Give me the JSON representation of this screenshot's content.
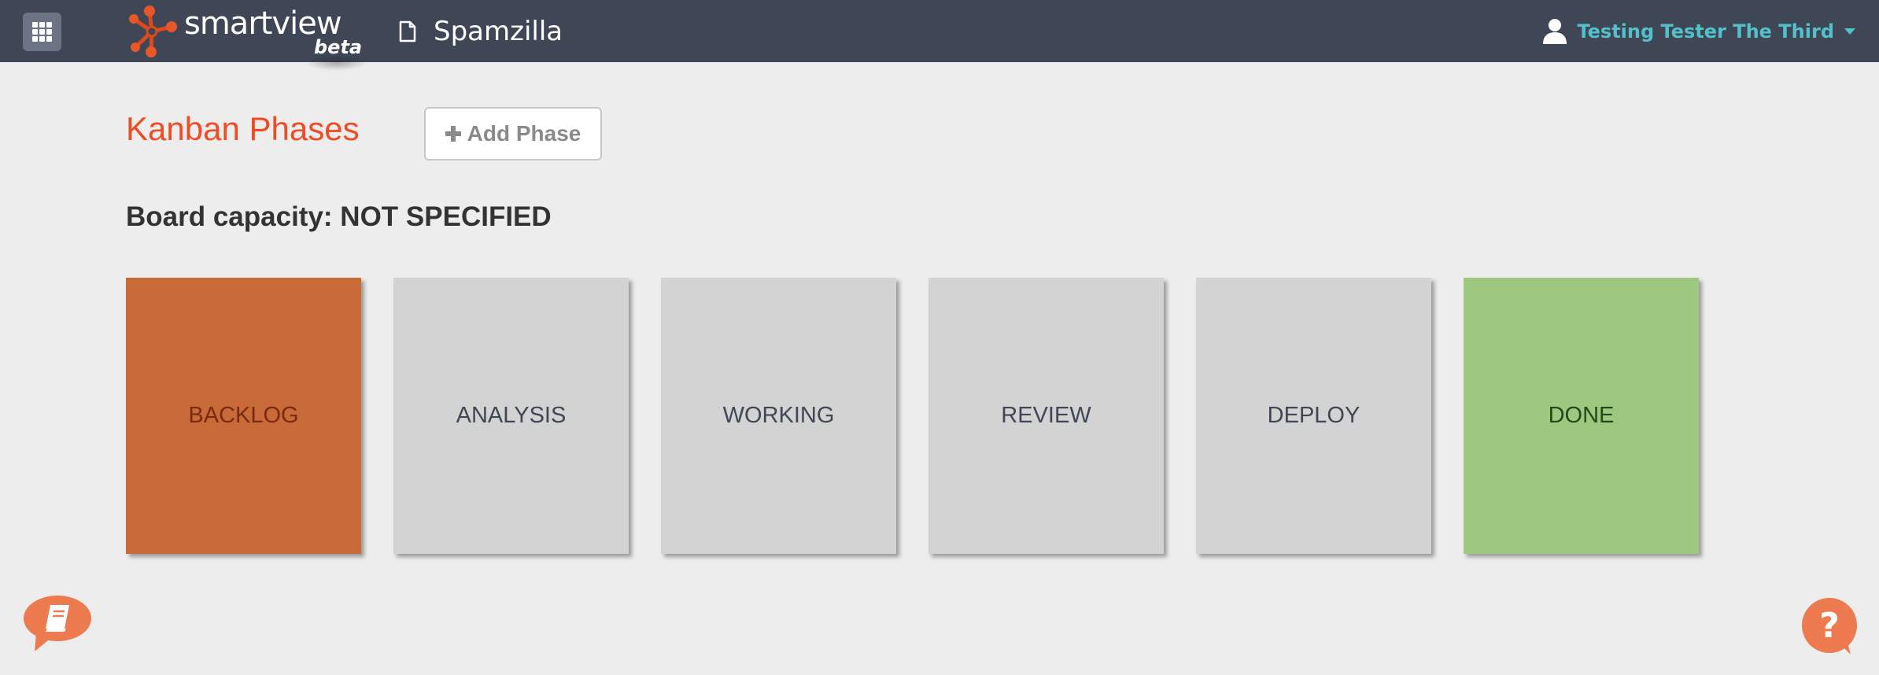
{
  "header": {
    "logo_text": "smartview",
    "logo_badge": "beta",
    "project_name": "Spamzilla",
    "user_name": "Testing Tester The Third"
  },
  "icons": {
    "apps": "apps-grid-icon",
    "project": "document-icon",
    "user": "user-icon",
    "user_caret": "caret-down-icon",
    "add": "plus-icon",
    "left_float": "book-chat-icon",
    "right_float": "help-chat-icon"
  },
  "main": {
    "title": "Kanban Phases",
    "add_phase_label": "Add Phase",
    "capacity_text": "Board capacity: NOT SPECIFIED"
  },
  "phases": [
    {
      "label": "BACKLOG",
      "bg": "#c96a39",
      "color": "#7a2a10"
    },
    {
      "label": "ANALYSIS",
      "bg": "#d3d3d3",
      "color": "#3f4757"
    },
    {
      "label": "WORKING",
      "bg": "#d3d3d3",
      "color": "#3f4757"
    },
    {
      "label": "REVIEW",
      "bg": "#d3d3d3",
      "color": "#3f4757"
    },
    {
      "label": "DEPLOY",
      "bg": "#d3d3d3",
      "color": "#3f4757"
    },
    {
      "label": "DONE",
      "bg": "#9ec880",
      "color": "#1f4a1a"
    }
  ],
  "colors": {
    "topbar": "#3f4757",
    "accent": "#ef4c23",
    "user_name": "#53c1c9",
    "chat_bubble": "#ee7b4f"
  }
}
